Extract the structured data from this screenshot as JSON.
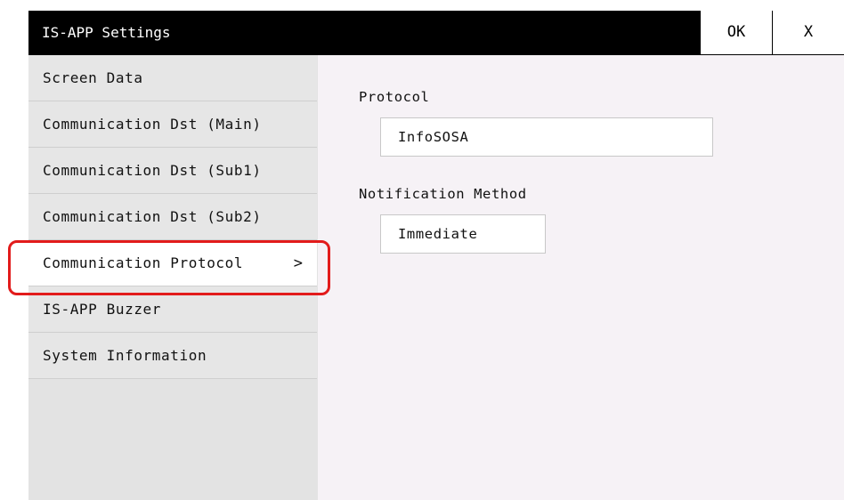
{
  "window": {
    "title": "IS-APP Settings",
    "ok_label": "OK",
    "close_label": "X"
  },
  "sidebar": {
    "items": [
      {
        "label": "Screen Data"
      },
      {
        "label": "Communication Dst (Main)"
      },
      {
        "label": "Communication Dst (Sub1)"
      },
      {
        "label": "Communication Dst (Sub2)"
      },
      {
        "label": "Communication Protocol",
        "selected": true,
        "chevron": ">"
      },
      {
        "label": "IS-APP Buzzer"
      },
      {
        "label": "System Information"
      }
    ]
  },
  "content": {
    "protocol_label": "Protocol",
    "protocol_value": "InfoSOSA",
    "notification_label": "Notification Method",
    "notification_value": "Immediate"
  },
  "colors": {
    "highlight": "#e21b1b",
    "titlebar": "#000000",
    "content_bg": "#f6f2f6",
    "sidebar_bg": "#e6e6e6"
  }
}
